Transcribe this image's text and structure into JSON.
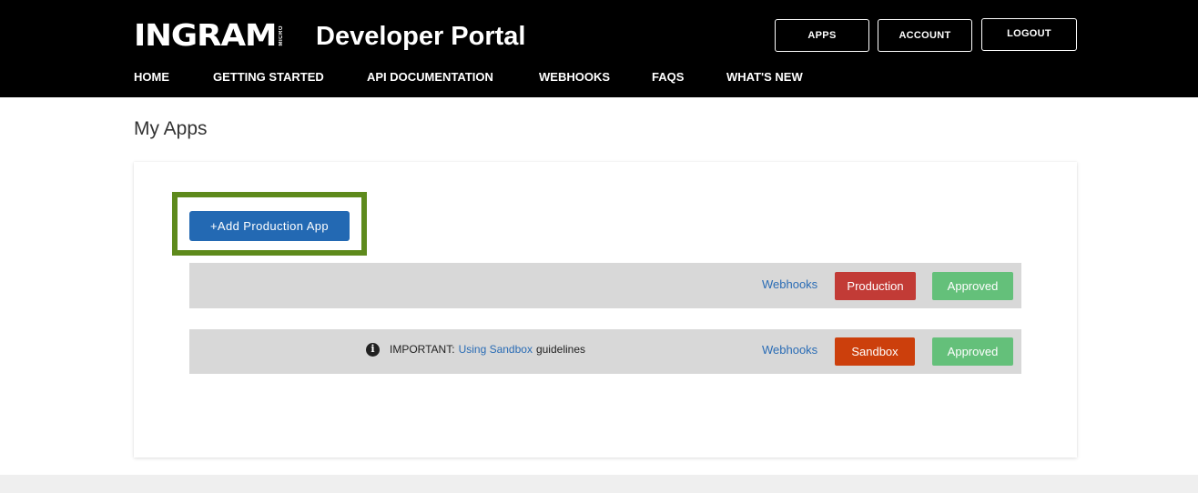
{
  "header": {
    "logo_text": "INGRAM",
    "logo_micro": "MICRO",
    "portal_title": "Developer Portal",
    "buttons": {
      "apps": "APPS",
      "account": "ACCOUNT",
      "logout": "LOGOUT"
    },
    "nav": [
      "HOME",
      "GETTING STARTED",
      "API DOCUMENTATION",
      "WEBHOOKS",
      "FAQS",
      "WHAT'S NEW"
    ]
  },
  "page": {
    "title": "My Apps"
  },
  "apps_panel": {
    "add_button_label": "+Add Production App",
    "rows": [
      {
        "webhooks_label": "Webhooks",
        "environment_label": "Production",
        "status_label": "Approved"
      },
      {
        "notice_prefix": "IMPORTANT:",
        "notice_link": "Using Sandbox",
        "notice_suffix": "guidelines",
        "webhooks_label": "Webhooks",
        "environment_label": "Sandbox",
        "status_label": "Approved"
      }
    ]
  },
  "colors": {
    "header_bg": "#000000",
    "primary_button": "#2369b3",
    "highlight_border": "#5e8a1c",
    "production_badge": "#c23b36",
    "sandbox_badge": "#cc3f0c",
    "approved_badge": "#64c07a",
    "link": "#2a6cb5",
    "row_bg": "#d8d8d8"
  },
  "icons": {
    "info": "info-circle-icon"
  }
}
